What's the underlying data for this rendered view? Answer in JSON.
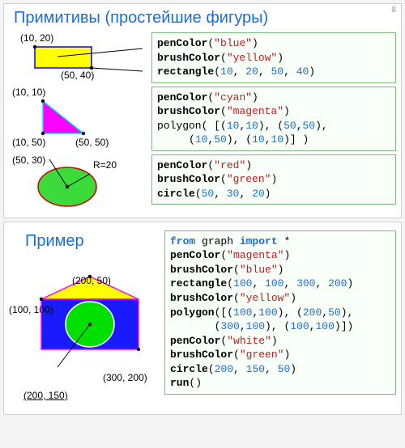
{
  "page_number": "8",
  "section1": {
    "title": "Примитивы (простейшие фигуры)",
    "rect": {
      "labels": {
        "tl": "(10, 20)",
        "br": "(50, 40)"
      },
      "code": [
        {
          "fn": "penColor",
          "args": [
            {
              "t": "str",
              "v": "\"blue\""
            }
          ]
        },
        {
          "fn": "brushColor",
          "args": [
            {
              "t": "str",
              "v": "\"yellow\""
            }
          ]
        },
        {
          "fn": "rectangle",
          "args": [
            {
              "t": "num",
              "v": "10"
            },
            {
              "t": "num",
              "v": "20"
            },
            {
              "t": "num",
              "v": "50"
            },
            {
              "t": "num",
              "v": "40"
            }
          ]
        }
      ]
    },
    "poly": {
      "labels": {
        "tl": "(10, 10)",
        "bl": "(10, 50)",
        "br": "(50, 50)"
      },
      "code": [
        {
          "fn": "penColor",
          "args": [
            {
              "t": "str",
              "v": "\"cyan\""
            }
          ]
        },
        {
          "fn": "brushColor",
          "args": [
            {
              "t": "str",
              "v": "\"magenta\""
            }
          ]
        },
        {
          "raw": "polygon( [(<n>10</n>,<n>10</n>), (<n>50</n>,<n>50</n>),\n     (<n>10</n>,<n>50</n>), (<n>10</n>,<n>10</n>)] )"
        }
      ]
    },
    "circ": {
      "labels": {
        "c": "(50, 30)",
        "r": "R=20"
      },
      "code": [
        {
          "fn": "penColor",
          "args": [
            {
              "t": "str",
              "v": "\"red\""
            }
          ]
        },
        {
          "fn": "brushColor",
          "args": [
            {
              "t": "str",
              "v": "\"green\""
            }
          ]
        },
        {
          "fn": "circle",
          "args": [
            {
              "t": "num",
              "v": "50"
            },
            {
              "t": "num",
              "v": "30"
            },
            {
              "t": "num",
              "v": "20"
            }
          ]
        }
      ]
    }
  },
  "section2": {
    "title": "Пример",
    "labels": {
      "top": "(200, 50)",
      "left": "(100, 100)",
      "center": "(200, 150)",
      "right": "(300, 200)"
    },
    "code": [
      {
        "raw": "<k>from</k> graph <k>import</k> *"
      },
      {
        "fn": "penColor",
        "args": [
          {
            "t": "str",
            "v": "\"magenta\""
          }
        ]
      },
      {
        "fn": "brushColor",
        "args": [
          {
            "t": "str",
            "v": "\"blue\""
          }
        ]
      },
      {
        "fn": "rectangle",
        "args": [
          {
            "t": "num",
            "v": "100"
          },
          {
            "t": "num",
            "v": "100"
          },
          {
            "t": "num",
            "v": "300"
          },
          {
            "t": "num",
            "v": "200"
          }
        ]
      },
      {
        "fn": "brushColor",
        "args": [
          {
            "t": "str",
            "v": "\"yellow\""
          }
        ]
      },
      {
        "raw": "<f>polygon</f>([(<n>100</n>,<n>100</n>), (<n>200</n>,<n>50</n>),\n       (<n>300</n>,<n>100</n>), (<n>100</n>,<n>100</n>)])"
      },
      {
        "fn": "penColor",
        "args": [
          {
            "t": "str",
            "v": "\"white\""
          }
        ]
      },
      {
        "fn": "brushColor",
        "args": [
          {
            "t": "str",
            "v": "\"green\""
          }
        ]
      },
      {
        "fn": "circle",
        "args": [
          {
            "t": "num",
            "v": "200"
          },
          {
            "t": "num",
            "v": "150"
          },
          {
            "t": "num",
            "v": "50"
          }
        ]
      },
      {
        "fn": "run",
        "args": []
      }
    ]
  }
}
